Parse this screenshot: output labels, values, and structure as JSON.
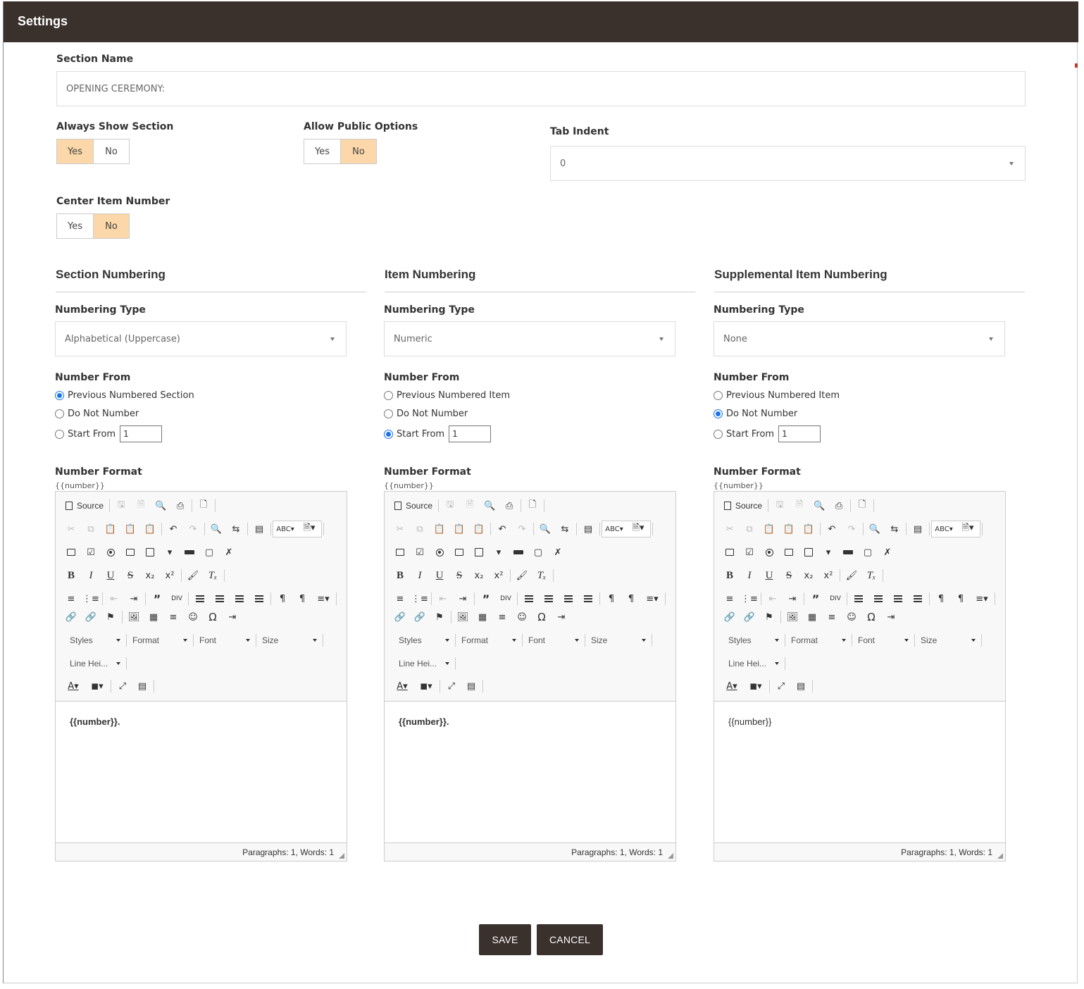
{
  "window": {
    "title": "Settings"
  },
  "section_name": {
    "label": "Section Name",
    "value": "OPENING CEREMONY:"
  },
  "always_show_section": {
    "label": "Always Show Section",
    "yes": "Yes",
    "no": "No",
    "selected": "Yes"
  },
  "allow_public_options": {
    "label": "Allow Public Options",
    "yes": "Yes",
    "no": "No",
    "selected": "No"
  },
  "tab_indent": {
    "label": "Tab Indent",
    "value": "0"
  },
  "center_item_number": {
    "label": "Center Item Number",
    "yes": "Yes",
    "no": "No",
    "selected": "No"
  },
  "columns": [
    {
      "heading": "Section Numbering",
      "numbering_type_label": "Numbering Type",
      "numbering_type": "Alphabetical (Uppercase)",
      "number_from_label": "Number From",
      "options": [
        "Previous Numbered Section",
        "Do Not Number",
        "Start From"
      ],
      "selected_option": 0,
      "start_from": "1",
      "number_format_label": "Number Format",
      "number_format_hint": "{{number}}",
      "editor_content": "{{number}}.",
      "editor_status": "Paragraphs: 1, Words: 1"
    },
    {
      "heading": "Item Numbering",
      "numbering_type_label": "Numbering Type",
      "numbering_type": "Numeric",
      "number_from_label": "Number From",
      "options": [
        "Previous Numbered Item",
        "Do Not Number",
        "Start From"
      ],
      "selected_option": 2,
      "start_from": "1",
      "number_format_label": "Number Format",
      "number_format_hint": "{{number}}",
      "editor_content": "{{number}}.",
      "editor_status": "Paragraphs: 1, Words: 1"
    },
    {
      "heading": "Supplemental Item Numbering",
      "numbering_type_label": "Numbering Type",
      "numbering_type": "None",
      "number_from_label": "Number From",
      "options": [
        "Previous Numbered Item",
        "Do Not Number",
        "Start From"
      ],
      "selected_option": 1,
      "start_from": "1",
      "number_format_label": "Number Format",
      "number_format_hint": "{{number}}",
      "editor_content": "{{number}}",
      "editor_status": "Paragraphs: 1, Words: 1"
    }
  ],
  "editor_toolbar": {
    "source": "Source",
    "styles": "Styles",
    "format": "Format",
    "font": "Font",
    "size": "Size",
    "line_height": "Line Hei..."
  },
  "footer": {
    "save": "SAVE",
    "cancel": "CANCEL"
  },
  "colors": {
    "header_bg": "#3a302c",
    "toggle_on": "#fbd7a9",
    "radio_on": "#1a73e8"
  }
}
